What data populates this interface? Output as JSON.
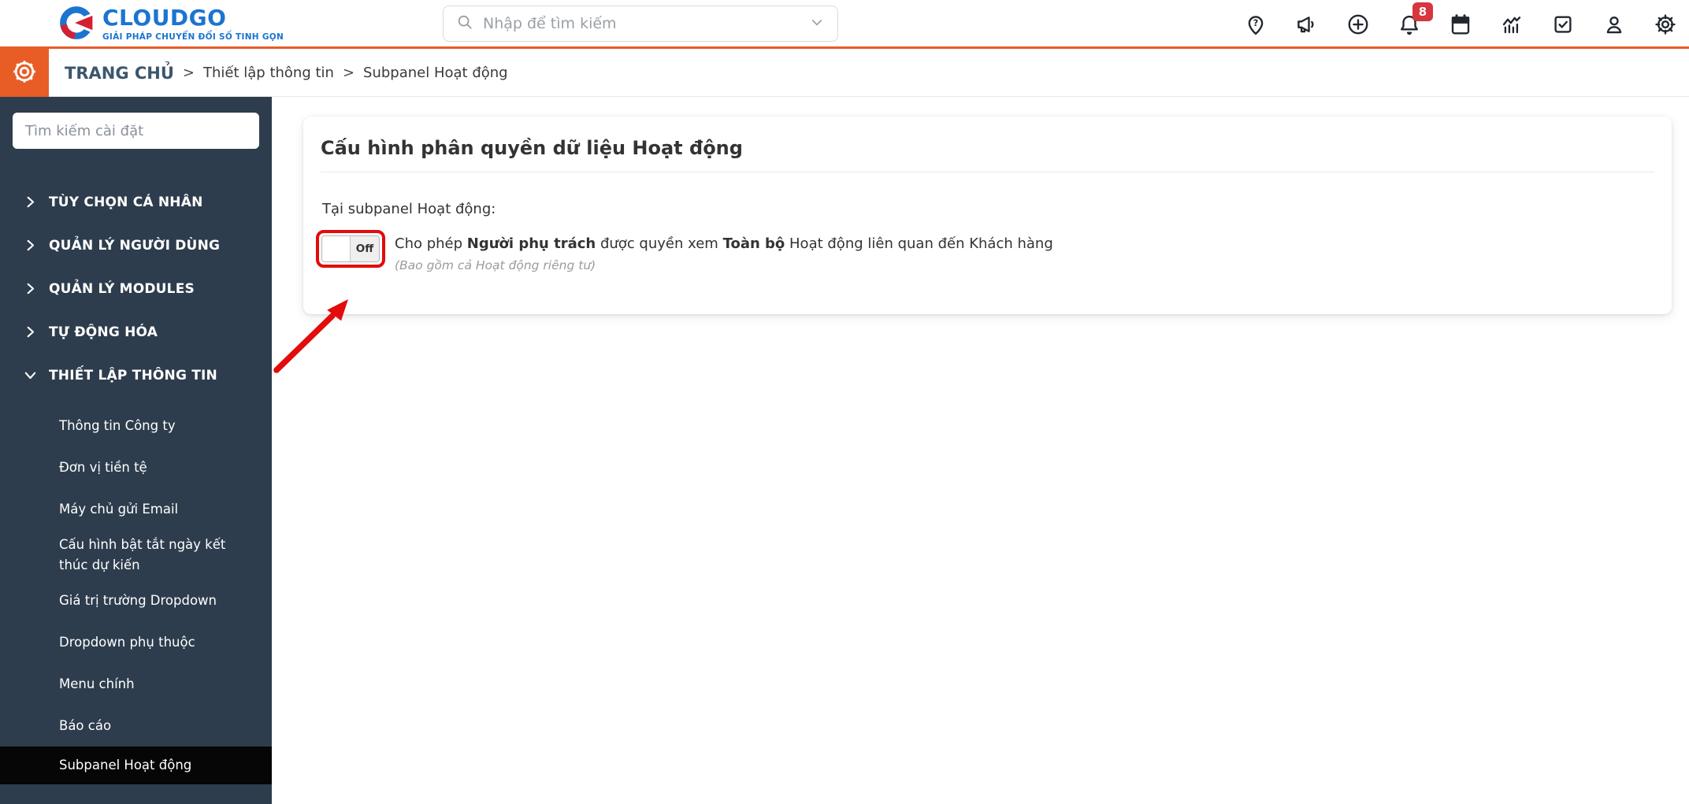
{
  "topbar": {
    "logo": {
      "name": "CLOUDGO",
      "tagline": "GIẢI PHÁP CHUYỂN ĐỔI SỐ TINH GỌN"
    },
    "search": {
      "placeholder": "Nhập để tìm kiếm"
    },
    "icons": [
      {
        "name": "location-question-icon"
      },
      {
        "name": "megaphone-icon"
      },
      {
        "name": "plus-circle-icon"
      },
      {
        "name": "bell-icon",
        "badge": "8"
      },
      {
        "name": "calendar-icon"
      },
      {
        "name": "chart-icon"
      },
      {
        "name": "tasks-check-icon"
      },
      {
        "name": "user-icon"
      },
      {
        "name": "settings-icon"
      }
    ]
  },
  "breadcrumb": {
    "home": "TRANG CHỦ",
    "separator": ">",
    "trail": [
      "Thiết lập thông tin",
      "Subpanel Hoạt động"
    ]
  },
  "sidebar": {
    "search_placeholder": "Tìm kiếm cài đặt",
    "sections": [
      {
        "label": "TÙY CHỌN CÁ NHÂN",
        "expanded": false
      },
      {
        "label": "QUẢN LÝ NGƯỜI DÙNG",
        "expanded": false
      },
      {
        "label": "QUẢN LÝ MODULES",
        "expanded": false
      },
      {
        "label": "TỰ ĐỘNG HÓA",
        "expanded": false
      },
      {
        "label": "THIẾT LẬP THÔNG TIN",
        "expanded": true,
        "children": [
          {
            "label": "Thông tin Công ty",
            "active": false
          },
          {
            "label": "Đơn vị tiền tệ",
            "active": false
          },
          {
            "label": "Máy chủ gửi Email",
            "active": false
          },
          {
            "label": "Cấu hình bật tắt ngày kết thúc dự kiến",
            "active": false
          },
          {
            "label": "Giá trị trường Dropdown",
            "active": false
          },
          {
            "label": "Dropdown phụ thuộc",
            "active": false
          },
          {
            "label": "Menu chính",
            "active": false
          },
          {
            "label": "Báo cáo",
            "active": false
          },
          {
            "label": "Subpanel Hoạt động",
            "active": true
          }
        ]
      }
    ]
  },
  "main": {
    "card_title": "Cấu hình phân quyền dữ liệu Hoạt động",
    "intro": "Tại subpanel Hoạt động:",
    "toggle": {
      "state_label": "Off"
    },
    "permission": {
      "prefix": "Cho phép ",
      "bold1": "Người phụ trách",
      "middle": " được quyền xem ",
      "bold2": "Toàn bộ",
      "suffix": " Hoạt động liên quan đến Khách hàng"
    },
    "note": "(Bao gồm cả Hoạt động riêng tư)"
  },
  "annotation": {
    "type": "red-arrow-and-highlight",
    "color": "#e30b0b"
  },
  "colors": {
    "accent_orange": "#e85d26",
    "sidebar_navy": "#2e3d4d",
    "active_black": "#060606",
    "logo_blue": "#1b74d1",
    "badge_red": "#d8353f",
    "annotation_red": "#e30b0b"
  }
}
